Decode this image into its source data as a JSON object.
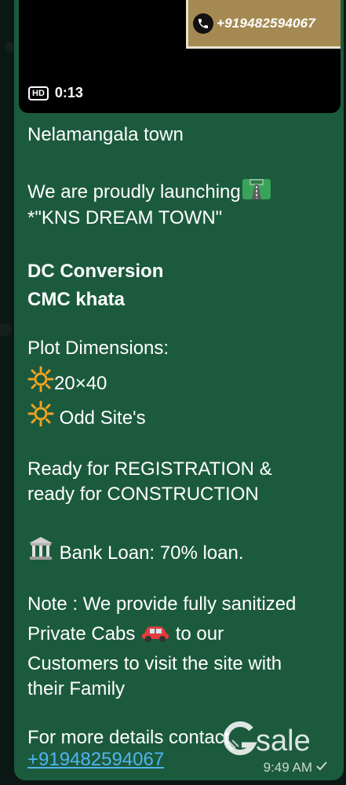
{
  "video": {
    "banner_phone": "+919482594067",
    "hd_label": "HD",
    "duration": "0:13"
  },
  "message": {
    "line1": "Nelamangala town",
    "line2": "We are proudly launching",
    "line3": "*\"KNS DREAM TOWN\"",
    "line4": "DC Conversion",
    "line5": "CMC khata",
    "line6": "Plot Dimensions:",
    "line7": "20×40",
    "line8": " Odd Site's",
    "line9": "Ready for REGISTRATION  &",
    "line10": "ready for CONSTRUCTION",
    "line11": " Bank Loan: 70% loan.",
    "line12": "Note : We provide fully sanitized",
    "line13a": "Private Cabs ",
    "line13b": " to our",
    "line14": "Customers to visit the site with",
    "line15": "their Family",
    "line16": "For more details contact",
    "phone_link": "+919482594067"
  },
  "meta": {
    "time": "9:49 AM",
    "status_icon": "single-check-icon"
  },
  "watermark": {
    "text": "sale"
  },
  "icons": [
    "phone-icon",
    "hd-icon",
    "motorway-emoji",
    "sun-emoji",
    "bank-emoji",
    "car-emoji",
    "gsale-logo-icon"
  ]
}
